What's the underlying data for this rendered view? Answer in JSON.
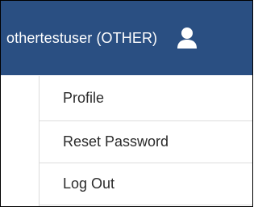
{
  "header": {
    "user_label": "othertestuser (OTHER)",
    "user_icon": "user-icon",
    "background_color": "#2a4f82",
    "text_color": "#ffffff"
  },
  "menu": {
    "items": [
      {
        "label": "Profile"
      },
      {
        "label": "Reset Password"
      },
      {
        "label": "Log Out"
      }
    ]
  }
}
